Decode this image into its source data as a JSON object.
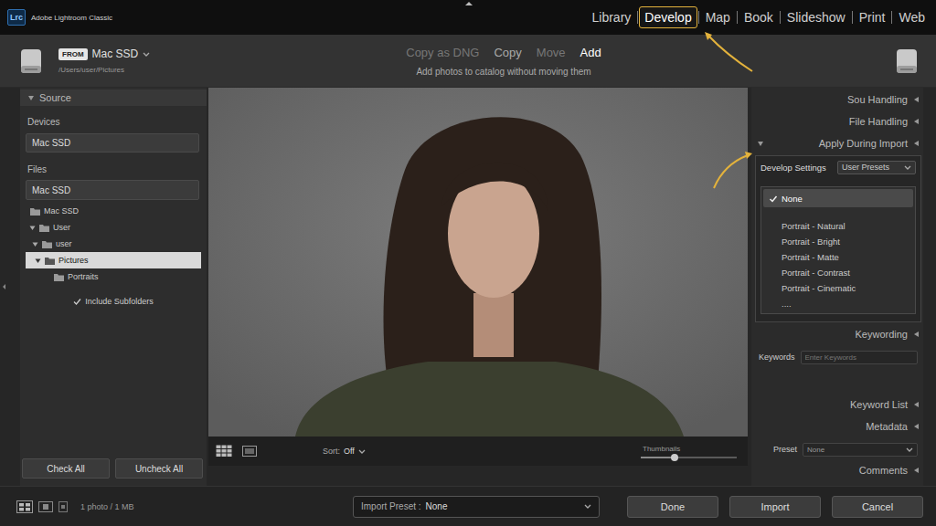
{
  "app": {
    "logo": "Lrc",
    "title": "Adobe Lightroom Classic"
  },
  "modules": [
    {
      "label": "Library",
      "selected": false
    },
    {
      "label": "Develop",
      "selected": true
    },
    {
      "label": "Map",
      "selected": false
    },
    {
      "label": "Book",
      "selected": false
    },
    {
      "label": "Slideshow",
      "selected": false
    },
    {
      "label": "Print",
      "selected": false
    },
    {
      "label": "Web",
      "selected": false
    }
  ],
  "import_header": {
    "from_badge": "FROM",
    "source": "Mac SSD",
    "path": "/Users/user/Pictures",
    "modes": [
      {
        "label": "Copy as DNG",
        "selected": false,
        "disabled": true
      },
      {
        "label": "Copy",
        "selected": false,
        "disabled": false
      },
      {
        "label": "Move",
        "selected": false,
        "disabled": true
      },
      {
        "label": "Add",
        "selected": true,
        "disabled": false
      }
    ],
    "mode_description": "Add photos to catalog without moving them"
  },
  "source_panel": {
    "title": "Source",
    "expanded": true,
    "devices_label": "Devices",
    "device": "Mac SSD",
    "files_label": "Files",
    "volume": "Mac SSD",
    "tree": [
      {
        "label": "Mac SSD",
        "depth": 0,
        "expanded": false,
        "selected": false
      },
      {
        "label": "User",
        "depth": 0,
        "expanded": true,
        "selected": false
      },
      {
        "label": "user",
        "depth": 1,
        "expanded": true,
        "selected": false
      },
      {
        "label": "Pictures",
        "depth": 2,
        "expanded": true,
        "selected": true
      },
      {
        "label": "Portraits",
        "depth": 3,
        "expanded": false,
        "selected": false
      }
    ],
    "include_subfolders": {
      "label": "Include Subfolders",
      "checked": true
    },
    "buttons": [
      "Check All",
      "Uncheck All"
    ]
  },
  "preview_toolbar": {
    "sort_label": "Sort:",
    "sort_value": "Off",
    "thumbnails_label": "Thumbnails",
    "thumbnail_size": 0.35
  },
  "right_panel": {
    "sections": [
      {
        "kind": "collapsed",
        "title": "Sou Handling",
        "expanded": false
      },
      {
        "kind": "collapsed",
        "title": "File Handling",
        "expanded": false
      },
      {
        "kind": "develop",
        "title": "Apply During Import",
        "expanded": true,
        "label": "Develop Settings",
        "value": "User Presets",
        "options": [
          {
            "label": "None",
            "selected": true
          },
          {
            "label": "Portrait - Natural",
            "selected": false
          },
          {
            "label": "Portrait - Bright",
            "selected": false
          },
          {
            "label": "Portrait - Matte",
            "selected": false
          },
          {
            "label": "Portrait - Contrast",
            "selected": false
          },
          {
            "label": "Portrait - Cinematic",
            "selected": false
          },
          {
            "label": "....",
            "selected": false
          }
        ]
      },
      {
        "kind": "keywords",
        "title": "Keywording",
        "expanded": true,
        "label": "Keywords",
        "placeholder": "Enter Keywords"
      },
      {
        "kind": "collapsed",
        "title": "Keyword List",
        "expanded": false
      },
      {
        "kind": "metadata",
        "title": "Metadata",
        "expanded": true,
        "label": "Preset",
        "value": "None"
      },
      {
        "kind": "collapsed",
        "title": "Comments",
        "expanded": false
      }
    ]
  },
  "bottom_bar": {
    "photo_count": "1 photo / 1 MB",
    "import_preset_label": "Import Preset :",
    "import_preset_value": "None",
    "buttons": [
      "Done",
      "Import",
      "Cancel"
    ]
  }
}
